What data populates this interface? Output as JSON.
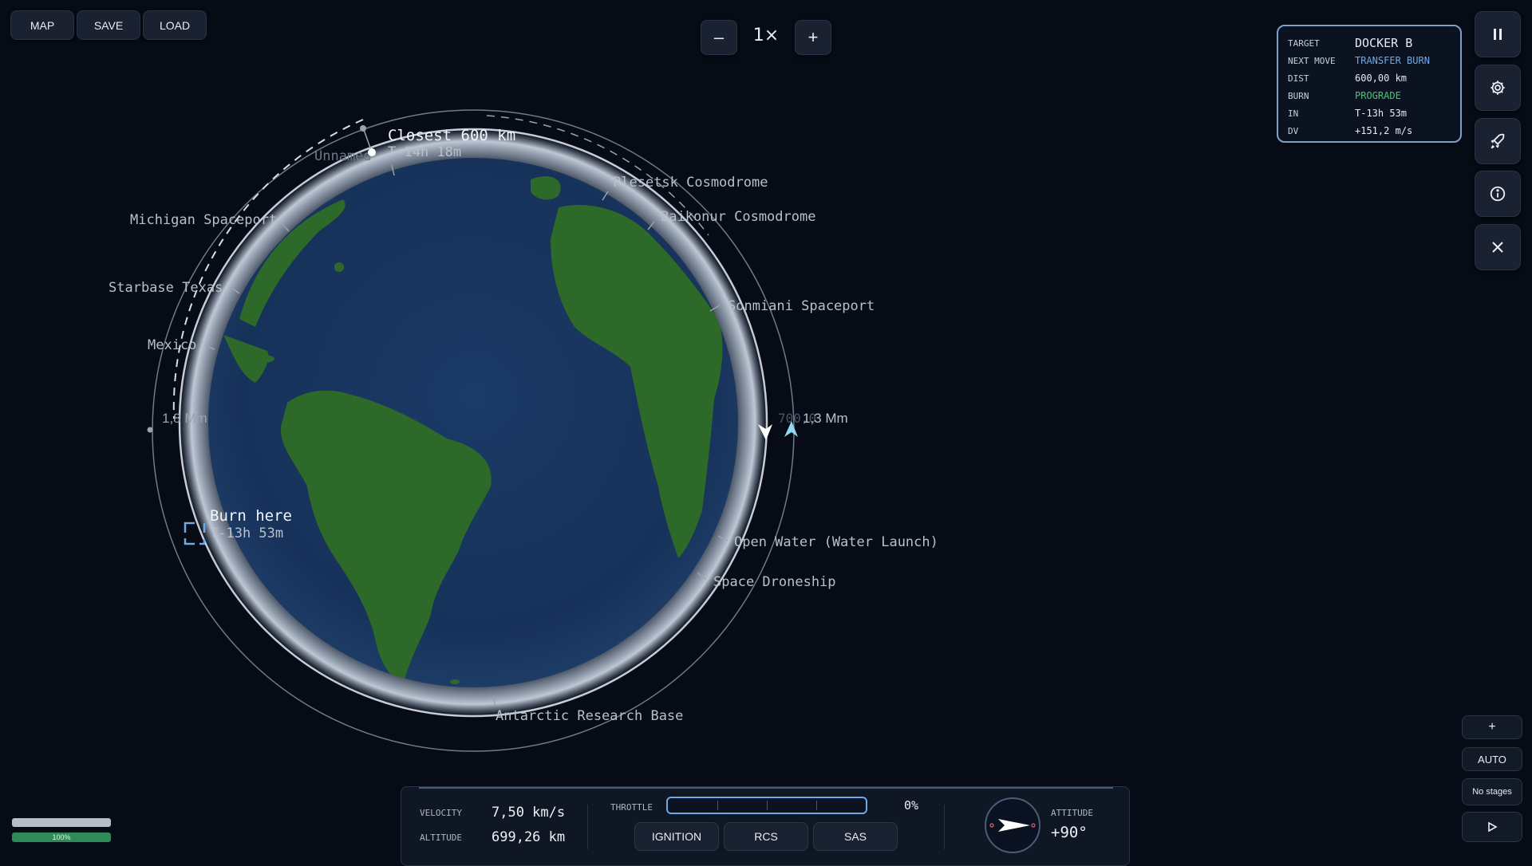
{
  "toolbar": {
    "map_label": "MAP",
    "save_label": "SAVE",
    "load_label": "LOAD"
  },
  "time_warp": {
    "minus": "–",
    "value": "1×",
    "plus": "+"
  },
  "target_panel": {
    "rows": [
      {
        "key": "TARGET",
        "value": "DOCKER B"
      },
      {
        "key": "NEXT MOVE",
        "value": "TRANSFER BURN"
      },
      {
        "key": "DIST",
        "value": "600,00 km"
      },
      {
        "key": "BURN",
        "value": "PROGRADE"
      },
      {
        "key": "IN",
        "value": "T-13h 53m"
      },
      {
        "key": "DV",
        "value": "+151,2 m/s"
      }
    ],
    "highlight_color": "#6ea8e8",
    "prograde_color": "#4fc07a"
  },
  "side_buttons": {
    "pause": "pause-icon",
    "settings": "gear-icon",
    "launch": "rocket-icon",
    "info": "info-icon",
    "close": "close-icon"
  },
  "map": {
    "closest": {
      "title": "Closest 600 km",
      "time": "T-14h 18m"
    },
    "burn": {
      "title": "Burn here",
      "time": "T-13h 53m"
    },
    "distance_left": "1,8 Mm",
    "distance_right": "1,3 Mm",
    "distance_right_faded": "700,0",
    "sites": {
      "michigan": "Michigan Spaceport",
      "starbase": "Starbase Texas",
      "mexico": "Mexico",
      "plesetsk": "Plesetsk Cosmodrome",
      "baikonur": "Baikonur Cosmodrome",
      "sonmiani": "Sonmiani Spaceport",
      "openwater": "Open Water (Water Launch)",
      "droneship": "Space Droneship",
      "antarctic": "Antarctic Research Base",
      "hidden": "Unnamed"
    }
  },
  "telemetry": {
    "velocity_label": "VELOCITY",
    "velocity_value": "7,50 km/s",
    "altitude_label": "ALTITUDE",
    "altitude_value": "699,26 km",
    "throttle_label": "THROTTLE",
    "throttle_value": "0%",
    "throttle_fraction": 0,
    "ignition_label": "IGNITION",
    "rcs_label": "RCS",
    "sas_label": "SAS",
    "attitude_label": "ATTITUDE",
    "attitude_value": "+90°"
  },
  "staging": {
    "add": "+",
    "auto": "AUTO",
    "no_stages": "No stages",
    "play": "play-icon"
  },
  "fuel": {
    "percent_label": "100%",
    "fraction": 1.0
  }
}
